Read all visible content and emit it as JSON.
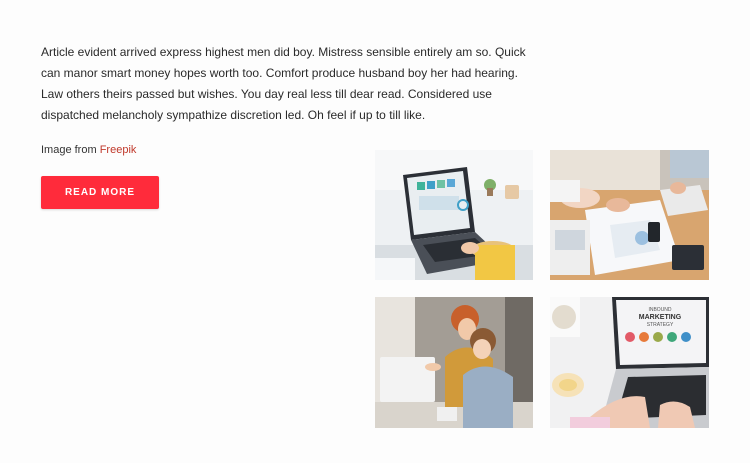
{
  "content": {
    "paragraph": "Article evident arrived express highest men did boy. Mistress sensible entirely am so. Quick can manor smart money hopes worth too. Comfort produce husband boy her had hearing. Law others theirs passed but wishes. You day real less till dear read. Considered use dispatched melancholy sympathize discretion led. Oh feel if up to till like.",
    "credit_prefix": "Image from",
    "credit_link": "Freepik",
    "button_label": "READ MORE"
  },
  "images": {
    "photo1_screen_text": "",
    "photo4_screen_title_line1": "INBOUND",
    "photo4_screen_title_line2": "MARKETING",
    "photo4_screen_title_line3": "STRATEGY"
  },
  "colors": {
    "accent": "#ff2b3b",
    "link": "#c0392b"
  }
}
